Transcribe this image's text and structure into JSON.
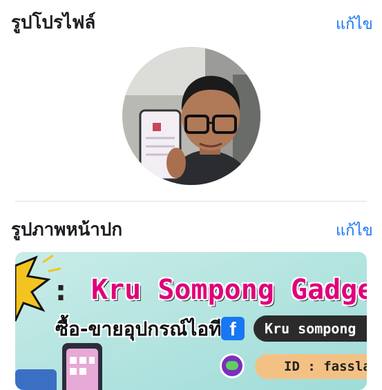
{
  "profile_section": {
    "title": "รูปโปรไฟล์",
    "edit_label": "แก้ไข"
  },
  "cover_section": {
    "title": "รูปภาพหน้าปก",
    "edit_label": "แก้ไข"
  },
  "cover_image": {
    "headline": "Kru Sompong Gadge",
    "colon": ":",
    "subtitle": "ซื้อ-ขายอุปกรณ์ไอที",
    "facebook_letter": "f",
    "facebook_name": "Kru sompong",
    "line_id": "ID : fasslabl"
  },
  "colors": {
    "accent_link": "#1877f2",
    "cover_background": "#c9ece8",
    "headline_pink": "#e0007a"
  },
  "icons": [
    "facebook-icon",
    "line-icon"
  ]
}
